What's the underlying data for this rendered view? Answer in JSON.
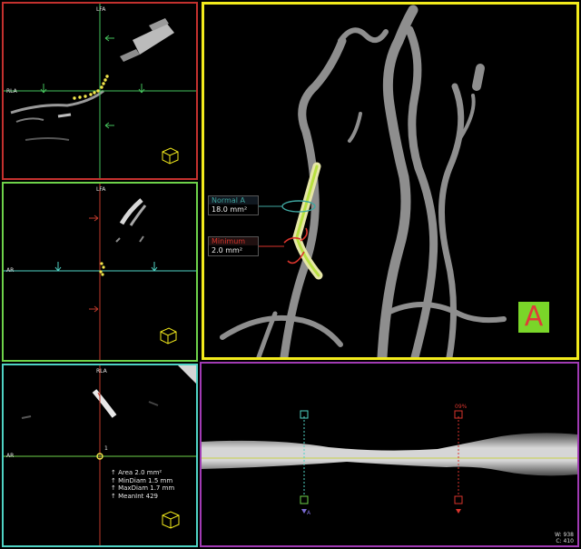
{
  "colors": {
    "sagittal_border": "#c4312e",
    "coronal_border": "#6ed24a",
    "axial_border": "#4fd2c4",
    "volume_border": "#f2ea1c",
    "curved_border": "#a13bb4",
    "crosshair_green": "#45c25c",
    "crosshair_red": "#c03a2c",
    "centerline_yellow": "#f2e64a",
    "normal_marker": "#3fa6a0",
    "minimum_marker": "#d8342c",
    "badge_green": "#7ad629",
    "badge_red": "#e03a3a"
  },
  "sagittal_view": {
    "top_label": "LFA",
    "left_label": "RLA",
    "orientation_icon": "orientation-cube-icon"
  },
  "coronal_view": {
    "top_label": "LFA",
    "left_label": "AR",
    "orientation_icon": "orientation-cube-icon"
  },
  "axial_view": {
    "top_label": "RLA",
    "left_label": "AR",
    "index_label": "1",
    "stats": {
      "area": "Area 2.0 mm²",
      "min_diam": "MinDiam 1.5 mm",
      "max_diam": "MaxDiam 1.7 mm",
      "mean_int": "MeanInt 429"
    },
    "orientation_icon": "orientation-cube-icon"
  },
  "volume_view": {
    "normal_label": "Normal A",
    "normal_value": "18.0 mm²",
    "minimum_label": "Minimum",
    "minimum_value": "2.0 mm²",
    "badge": "A"
  },
  "curved_view": {
    "marker_percent": "09%",
    "marker_a": "A",
    "window": "W: 938",
    "center": "C: 410"
  }
}
